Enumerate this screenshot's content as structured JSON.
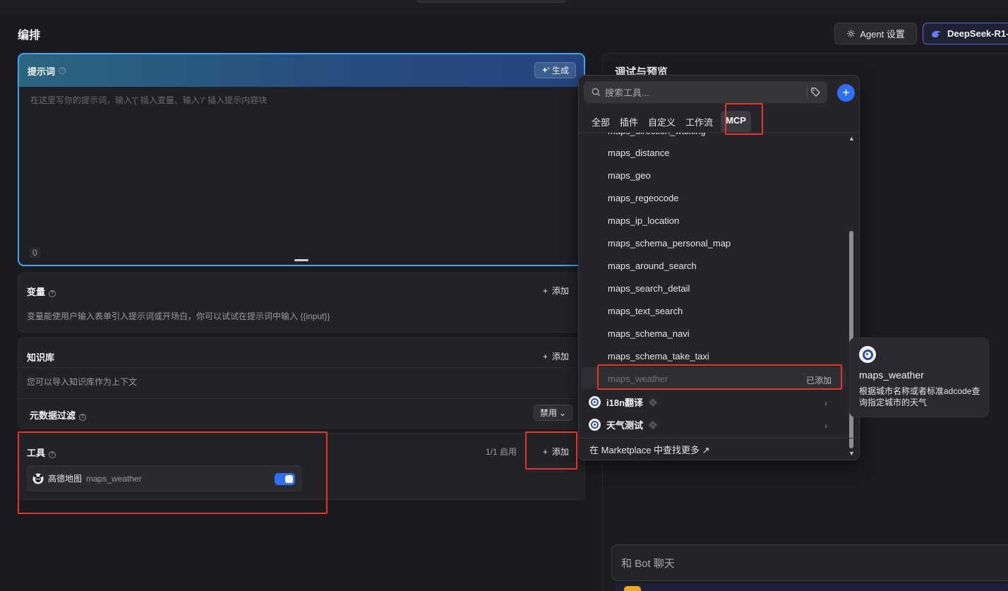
{
  "header": {
    "page_title": "编排",
    "agent_settings": "Agent 设置",
    "model_name": "DeepSeek-R1-"
  },
  "prompt": {
    "label": "提示词",
    "generate": "生成",
    "placeholder": "在这里写你的提示词，输入'{' 插入变量、输入'/' 插入提示内容块",
    "count": "0"
  },
  "variables": {
    "title": "变量",
    "add": "添加",
    "desc": "变量能使用户输入表单引入提示词或开场白，你可以试试在提示词中输入 {{input}}"
  },
  "knowledge": {
    "title": "知识库",
    "add": "添加",
    "desc": "您可以导入知识库作为上下文",
    "metadata_filter": "元数据过滤",
    "disable_btn": "禁用"
  },
  "tools": {
    "title": "工具",
    "enabled_count": "1/1 启用",
    "add": "添加",
    "item_provider": "高德地图",
    "item_name": "maps_weather",
    "item_enabled": true
  },
  "preview": {
    "title": "调试与预览",
    "chat_placeholder": "和 Bot 聊天"
  },
  "tool_picker": {
    "search_placeholder": "搜索工具...",
    "tabs": [
      "全部",
      "插件",
      "自定义",
      "工作流",
      "MCP"
    ],
    "active_tab": "MCP",
    "partial_item": "maps_direction_walking",
    "items": [
      "maps_distance",
      "maps_geo",
      "maps_regeocode",
      "maps_ip_location",
      "maps_schema_personal_map",
      "maps_around_search",
      "maps_search_detail",
      "maps_text_search",
      "maps_schema_navi",
      "maps_schema_take_taxi"
    ],
    "added_item": "maps_weather",
    "added_tag": "已添加",
    "groups": [
      "i18n翻译",
      "天气测试"
    ],
    "footer_link": "在 Marketplace 中查找更多 ↗"
  },
  "tooltip": {
    "title": "maps_weather",
    "desc": "根据城市名称或者标准adcode查询指定城市的天气"
  },
  "colors": {
    "accent": "#2f6ff3",
    "highlight_border": "#e8332a",
    "prompt_border": "#3ba7f5"
  }
}
